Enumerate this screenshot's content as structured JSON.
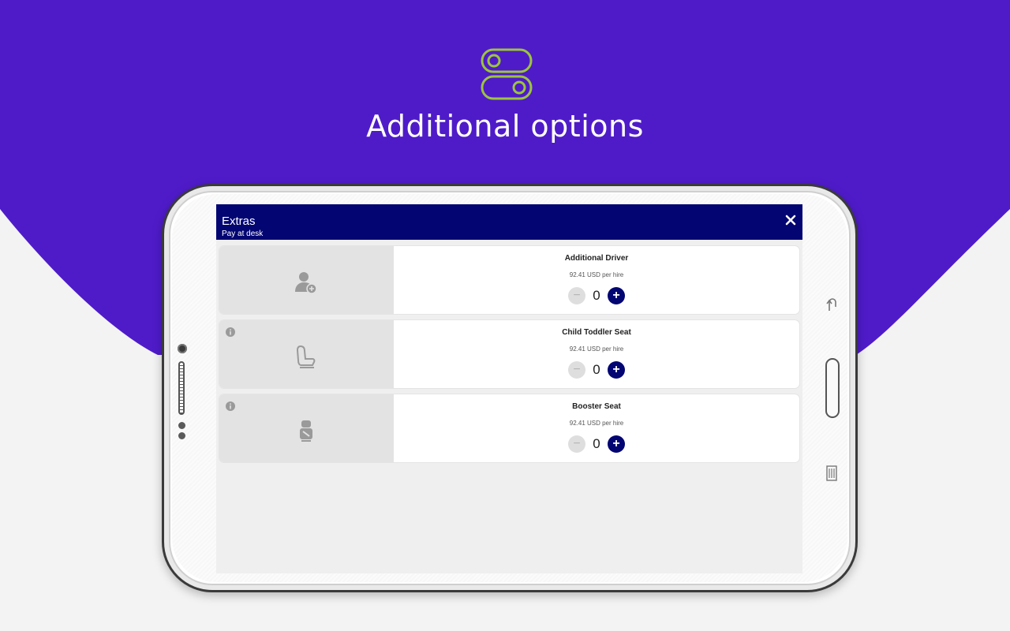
{
  "colors": {
    "purple": "#4f1bc9",
    "navy": "#020572",
    "icon_green": "#9bc53d"
  },
  "hero": {
    "title": "Additional options",
    "icon": "toggle-switches-icon"
  },
  "appbar": {
    "title": "Extras",
    "subtitle": "Pay at desk",
    "close_icon": "close-icon"
  },
  "extras": [
    {
      "name": "Additional Driver",
      "price": "92.41 USD per hire",
      "quantity": "0",
      "icon": "add-person-icon",
      "has_info": false
    },
    {
      "name": "Child Toddler Seat",
      "price": "92.41 USD per hire",
      "quantity": "0",
      "icon": "child-seat-icon",
      "has_info": true
    },
    {
      "name": "Booster Seat",
      "price": "92.41 USD per hire",
      "quantity": "0",
      "icon": "booster-seat-icon",
      "has_info": true
    }
  ],
  "stepper": {
    "minus": "−",
    "plus": "+"
  }
}
